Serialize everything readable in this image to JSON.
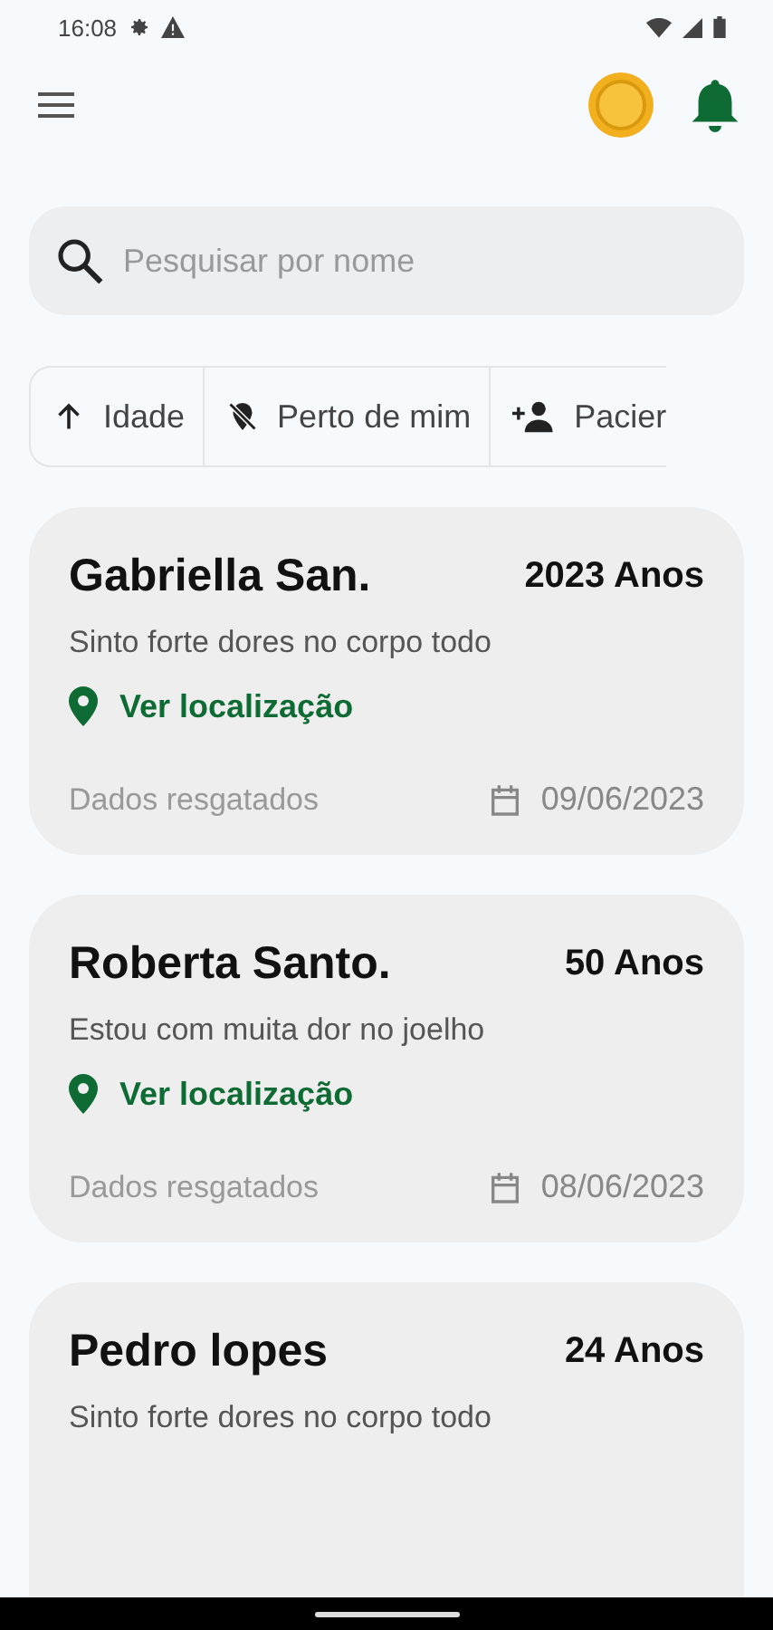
{
  "status_bar": {
    "time": "16:08"
  },
  "search": {
    "placeholder": "Pesquisar por nome"
  },
  "filters": [
    {
      "kind": "age",
      "label": "Idade"
    },
    {
      "kind": "near",
      "label": "Perto de mim"
    },
    {
      "kind": "patient",
      "label": "Pacier"
    }
  ],
  "patients": [
    {
      "name": "Gabriella San.",
      "age": "2023 Anos",
      "complaint": "Sinto forte dores no corpo todo",
      "location": "Ver localização",
      "status": "Dados resgatados",
      "date": "09/06/2023"
    },
    {
      "name": "Roberta Santo.",
      "age": "50 Anos",
      "complaint": "Estou com muita dor no joelho",
      "location": "Ver localização",
      "status": "Dados resgatados",
      "date": "08/06/2023"
    },
    {
      "name": "Pedro lopes",
      "age": "24 Anos",
      "complaint": "Sinto forte dores no corpo todo"
    }
  ]
}
